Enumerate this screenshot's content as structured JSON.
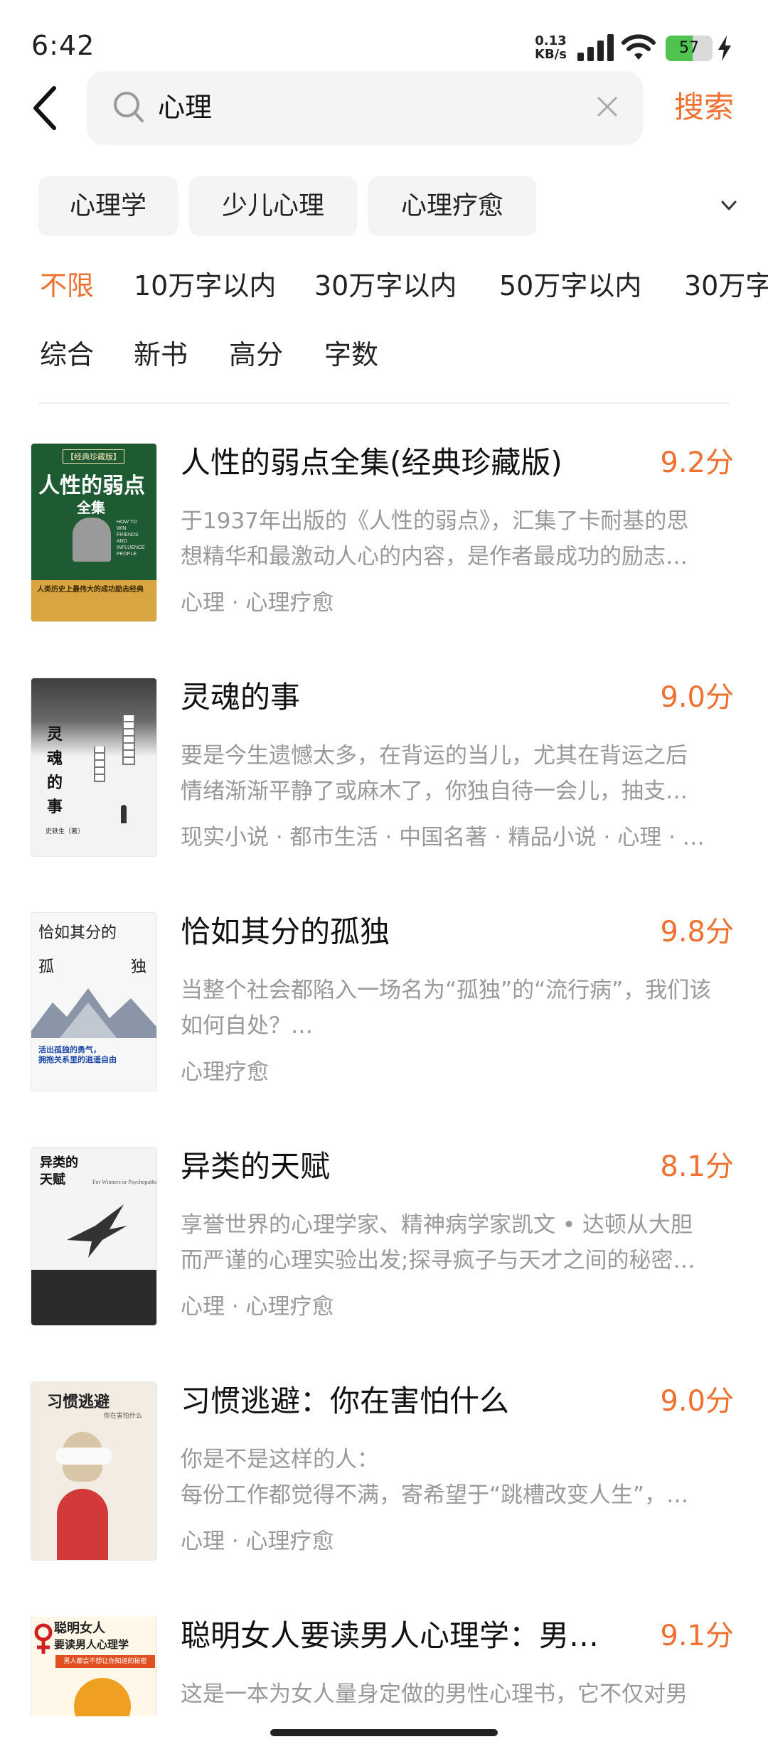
{
  "status_bar": {
    "time": "6:42",
    "net_speed_value": "0.13",
    "net_speed_unit": "KB/s",
    "battery_level": "57",
    "battery_color": "#4fc24f"
  },
  "search": {
    "query": "心理",
    "search_button": "搜索"
  },
  "category_chips": [
    "心理学",
    "少儿心理",
    "心理疗愈"
  ],
  "word_filters": [
    "不限",
    "10万字以内",
    "30万字以内",
    "50万字以内",
    "30万字"
  ],
  "sort_options": [
    "综合",
    "新书",
    "高分",
    "字数"
  ],
  "accent_color": "#f07030",
  "books": [
    {
      "title": "人性的弱点全集(经典珍藏版)",
      "score": "9.2分",
      "desc": [
        "于1937年出版的《人性的弱点》，汇集了卡耐基的思",
        "想精华和最激动人心的内容，是作者最成功的励志…"
      ],
      "tags": "心理 · 心理疗愈",
      "cover": {
        "badge": "【经典珍藏版】",
        "title": "人性的弱点",
        "subtitle": "全集",
        "en_lines": [
          "HOW TO",
          "WIN",
          "FRIENDS",
          "AND",
          "INFLUENCE",
          "PEOPLE"
        ],
        "slogan": "人类历史上最伟大的成功励志经典"
      }
    },
    {
      "title": "灵魂的事",
      "score": "9.0分",
      "desc": [
        "要是今生遗憾太多，在背运的当儿，尤其在背运之后",
        "情绪渐渐平静了或麻木了，你独自待一会儿，抽支…"
      ],
      "tags": "现实小说 · 都市生活 · 中国名著 · 精品小说 · 心理 · …",
      "cover": {
        "title_chars": [
          "灵",
          "魂",
          "的",
          "事"
        ],
        "author": "史铁生〔著〕"
      }
    },
    {
      "title": "恰如其分的孤独",
      "score": "9.8分",
      "desc": [
        "当整个社会都陷入一场名为“孤独”的“流行病”，我们该",
        "如何自处？…"
      ],
      "tags": "心理疗愈",
      "cover": {
        "title_top": "恰如其分的",
        "title_left": "孤",
        "title_right": "独",
        "tagline": [
          "活出孤独的勇气，",
          "拥抱关系里的逍遥自由"
        ]
      }
    },
    {
      "title": "异类的天赋",
      "score": "8.1分",
      "desc": [
        "享誉世界的心理学家、精神病学家凯文 • 达顿从大胆",
        "而严谨的心理实验出发;探寻疯子与天才之间的秘密…"
      ],
      "tags": "心理 · 心理疗愈",
      "cover": {
        "title_lines": [
          "异类的",
          "天赋"
        ],
        "en": "For Winners or Psychopaths"
      }
    },
    {
      "title": "习惯逃避：你在害怕什么",
      "score": "9.0分",
      "desc": [
        "你是不是这样的人：",
        "每份工作都觉得不满，寄希望于“跳槽改变人生”，…"
      ],
      "tags": "心理 · 心理疗愈",
      "cover": {
        "title": "习惯逃避",
        "subtitle": "你在害怕什么"
      }
    },
    {
      "title": "聪明女人要读男人心理学：男…",
      "score": "9.1分",
      "desc": [
        "这是一本为女人量身定做的男性心理书，它不仅对男",
        ""
      ],
      "tags": "",
      "cover": {
        "title_lines": [
          "聪明女人",
          "要读男人心理学"
        ],
        "banner": "男人都会不想让你知道的秘密"
      }
    }
  ]
}
